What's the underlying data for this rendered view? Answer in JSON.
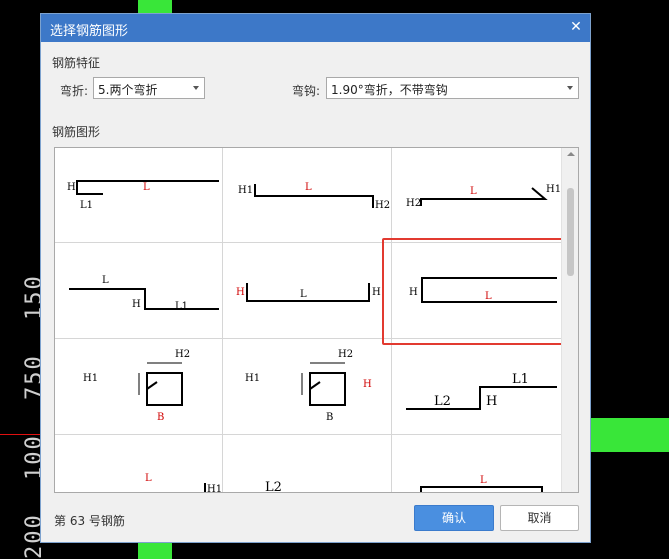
{
  "window": {
    "title": "选择钢筋图形"
  },
  "features": {
    "section_label": "钢筋特征",
    "bend_label": "弯折:",
    "bend_value": "5.两个弯折",
    "hook_label": "弯钩:",
    "hook_value": "1.90°弯折，不带弯钩"
  },
  "shapes": {
    "section_label": "钢筋图形",
    "labels": {
      "H": "H",
      "H1": "H1",
      "H2": "H2",
      "L": "L",
      "L1": "L1",
      "L2": "L2",
      "B": "B"
    }
  },
  "status": {
    "text": "第 63 号钢筋"
  },
  "buttons": {
    "ok": "确认",
    "cancel": "取消"
  },
  "background": {
    "cad_texts": [
      "150",
      "750",
      "100",
      "200"
    ]
  },
  "colors": {
    "title_bar": "#3d78c8",
    "highlight": "#e23a30",
    "label_red": "#d00000",
    "primary_button": "#4a8fe0"
  }
}
